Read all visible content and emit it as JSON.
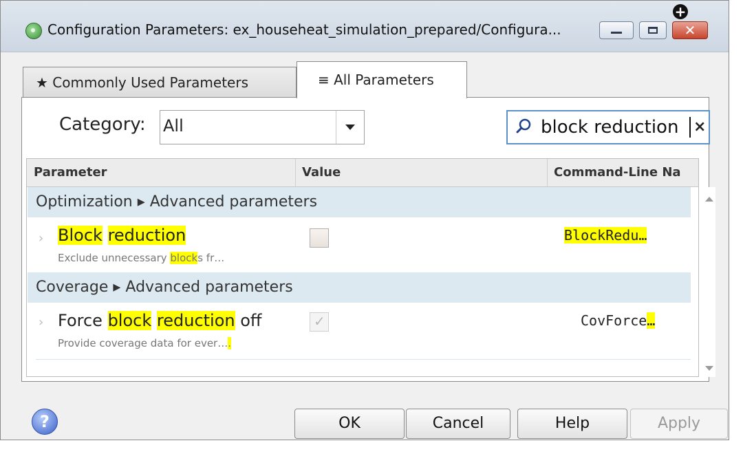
{
  "window": {
    "title": "Configuration Parameters: ex_househeat_simulation_prepared/Configura...",
    "close_label": "✕"
  },
  "tabs": [
    {
      "label": "★ Commonly Used Parameters",
      "active": false
    },
    {
      "label": "≡ All Parameters",
      "active": true
    }
  ],
  "category": {
    "label": "Category:",
    "value": "All"
  },
  "search": {
    "value": "block reduction",
    "clear_label": "×"
  },
  "table": {
    "columns": [
      "Parameter",
      "Value",
      "Command-Line Na"
    ],
    "add_column_label": "+",
    "groups": [
      {
        "title": "Optimization ▸ Advanced parameters",
        "params": [
          {
            "name_parts": [
              {
                "text": "Block",
                "hl": true
              },
              {
                "text": " ",
                "hl": false
              },
              {
                "text": "reduction",
                "hl": true
              }
            ],
            "desc_parts": [
              {
                "text": "Exclude unnecessary ",
                "hl": false
              },
              {
                "text": "block",
                "hl": true
              },
              {
                "text": "s fr…",
                "hl": false
              }
            ],
            "value_checked": false,
            "cmd_parts": [
              {
                "text": "BlockRedu…",
                "hl": true
              }
            ]
          }
        ]
      },
      {
        "title": "Coverage ▸ Advanced parameters",
        "params": [
          {
            "name_parts": [
              {
                "text": "Force ",
                "hl": false
              },
              {
                "text": "block",
                "hl": true
              },
              {
                "text": " ",
                "hl": false
              },
              {
                "text": "reduction",
                "hl": true
              },
              {
                "text": " off",
                "hl": false
              }
            ],
            "desc_parts": [
              {
                "text": "Provide coverage data for ever…",
                "hl": false
              },
              {
                "text": ".",
                "hl": true
              }
            ],
            "value_checked": true,
            "cmd_parts": [
              {
                "text": "CovForce",
                "hl": false
              },
              {
                "text": "…",
                "hl": true
              }
            ]
          }
        ]
      }
    ]
  },
  "buttons": {
    "help_icon": "?",
    "ok": "OK",
    "cancel": "Cancel",
    "help": "Help",
    "apply": "Apply"
  },
  "colors": {
    "highlight": "#ffff00",
    "group_row": "#dde9f1",
    "search_border": "#5b91c9"
  }
}
